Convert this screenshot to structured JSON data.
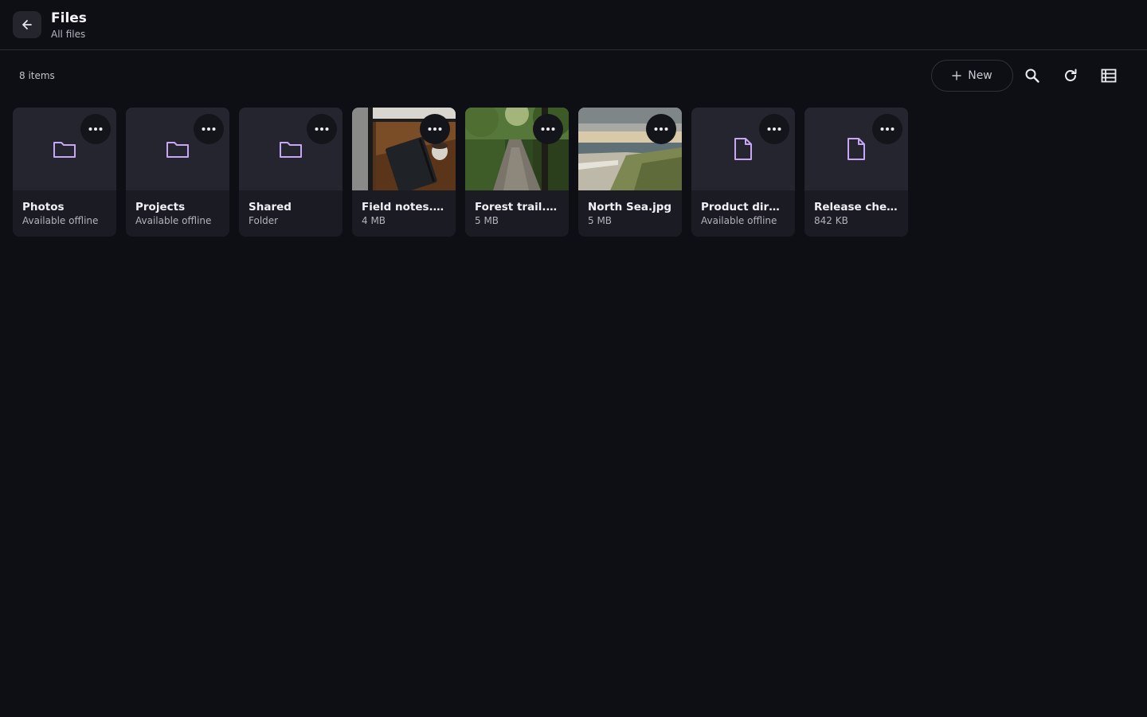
{
  "header": {
    "title": "Files",
    "subtitle": "All files"
  },
  "toolbar": {
    "item_count": "8 items",
    "new_label": "New"
  },
  "colors": {
    "background": "#0e0f14",
    "card": "#1b1c23",
    "accent": "#c7a6f5"
  },
  "items": [
    {
      "name": "Photos",
      "meta": "Available offline",
      "kind": "folder",
      "icon": "folder-icon"
    },
    {
      "name": "Projects",
      "meta": "Available offline",
      "kind": "folder",
      "icon": "folder-icon"
    },
    {
      "name": "Shared",
      "meta": "Folder",
      "kind": "folder",
      "icon": "folder-icon"
    },
    {
      "name": "Field notes.jpg",
      "meta": "4 MB",
      "kind": "image",
      "icon": "image-thumbnail"
    },
    {
      "name": "Forest trail.jpg",
      "meta": "5 MB",
      "kind": "image",
      "icon": "image-thumbnail"
    },
    {
      "name": "North Sea.jpg",
      "meta": "5 MB",
      "kind": "image",
      "icon": "image-thumbnail"
    },
    {
      "name": "Product directory",
      "meta": "Available offline",
      "kind": "document",
      "icon": "document-icon"
    },
    {
      "name": "Release checklist",
      "meta": "842 KB",
      "kind": "document",
      "icon": "document-icon"
    }
  ]
}
